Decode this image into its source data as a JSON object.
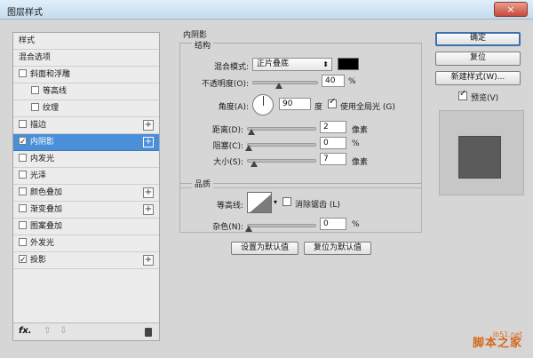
{
  "window": {
    "title": "图层样式",
    "close": "×"
  },
  "style_list": {
    "items": [
      {
        "label": "样式",
        "checkbox": false,
        "checked": false,
        "plus": false,
        "indent": 0,
        "selected": false
      },
      {
        "label": "混合选项",
        "checkbox": false,
        "checked": false,
        "plus": false,
        "indent": 0,
        "selected": false
      },
      {
        "label": "斜面和浮雕",
        "checkbox": true,
        "checked": false,
        "plus": false,
        "indent": 0,
        "selected": false
      },
      {
        "label": "等高线",
        "checkbox": true,
        "checked": false,
        "plus": false,
        "indent": 1,
        "selected": false
      },
      {
        "label": "纹理",
        "checkbox": true,
        "checked": false,
        "plus": false,
        "indent": 1,
        "selected": false
      },
      {
        "label": "描边",
        "checkbox": true,
        "checked": false,
        "plus": true,
        "indent": 0,
        "selected": false
      },
      {
        "label": "内阴影",
        "checkbox": true,
        "checked": true,
        "plus": true,
        "indent": 0,
        "selected": true
      },
      {
        "label": "内发光",
        "checkbox": true,
        "checked": false,
        "plus": false,
        "indent": 0,
        "selected": false
      },
      {
        "label": "光泽",
        "checkbox": true,
        "checked": false,
        "plus": false,
        "indent": 0,
        "selected": false
      },
      {
        "label": "颜色叠加",
        "checkbox": true,
        "checked": false,
        "plus": true,
        "indent": 0,
        "selected": false
      },
      {
        "label": "渐变叠加",
        "checkbox": true,
        "checked": false,
        "plus": true,
        "indent": 0,
        "selected": false
      },
      {
        "label": "图案叠加",
        "checkbox": true,
        "checked": false,
        "plus": false,
        "indent": 0,
        "selected": false
      },
      {
        "label": "外发光",
        "checkbox": true,
        "checked": false,
        "plus": false,
        "indent": 0,
        "selected": false
      },
      {
        "label": "投影",
        "checkbox": true,
        "checked": true,
        "plus": true,
        "indent": 0,
        "selected": false
      }
    ],
    "footer": {
      "fx": "fx.",
      "up": "⇧",
      "down": "⇩"
    }
  },
  "inner_shadow": {
    "title": "内阴影",
    "structure": {
      "title": "结构",
      "blend_mode_label": "混合模式:",
      "blend_mode_value": "正片叠底",
      "opacity_label": "不透明度(O):",
      "opacity_value": "40",
      "opacity_unit": "%",
      "opacity_level": 0.4,
      "angle_label": "角度(A):",
      "angle_value": "90",
      "angle_unit": "度",
      "global_light_label": "使用全局光 (G)",
      "global_light_checked": true,
      "distance_label": "距离(D):",
      "distance_value": "2",
      "distance_unit": "像素",
      "choke_label": "阻塞(C):",
      "choke_value": "0",
      "choke_unit": "%",
      "size_label": "大小(S):",
      "size_value": "7",
      "size_unit": "像素"
    },
    "quality": {
      "title": "品质",
      "contour_label": "等高线:",
      "anti_alias_label": "消除锯齿 (L)",
      "anti_alias_checked": false,
      "noise_label": "杂色(N):",
      "noise_value": "0",
      "noise_unit": "%"
    },
    "make_default": "设置为默认值",
    "reset_default": "复位为默认值"
  },
  "buttons": {
    "ok": "确定",
    "reset": "复位",
    "new_style": "新建样式(W)...",
    "preview_label": "预览(V)",
    "preview_checked": true
  },
  "watermark": {
    "line1": "jb51.net",
    "line2": "脚本之家"
  },
  "colors": {
    "selected_row": "#4a8fd7",
    "shadow_color": "#000000",
    "preview_square": "#5b5b5b",
    "watermark": "#e26b1d"
  }
}
